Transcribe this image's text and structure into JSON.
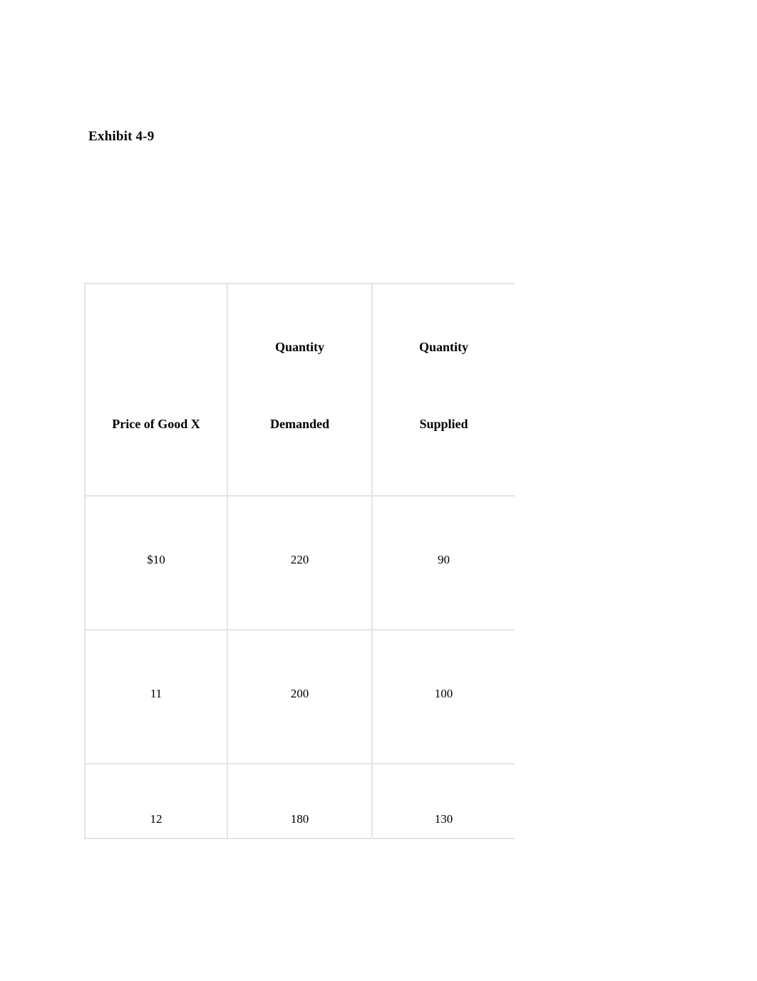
{
  "document": {
    "exhibit_title": "Exhibit 4-9",
    "background_color": "#ffffff",
    "text_color": "#000000",
    "table_border_color": "#e2e2e2"
  },
  "table": {
    "columns": [
      {
        "line1": "",
        "line2": "Price of Good X",
        "single_line": true
      },
      {
        "line1": "Quantity",
        "line2": "Demanded",
        "single_line": false
      },
      {
        "line1": "Quantity",
        "line2": "Supplied",
        "single_line": false
      }
    ],
    "rows": [
      {
        "price": "$10",
        "quantity_demanded": "220",
        "quantity_supplied": "90"
      },
      {
        "price": "11",
        "quantity_demanded": "200",
        "quantity_supplied": "100"
      },
      {
        "price": "12",
        "quantity_demanded": "180",
        "quantity_supplied": "130"
      }
    ]
  },
  "chart_data": {
    "type": "table",
    "title": "Exhibit 4-9",
    "columns": [
      "Price of Good X",
      "Quantity Demanded",
      "Quantity Supplied"
    ],
    "rows": [
      [
        "$10",
        "220",
        "90"
      ],
      [
        "11",
        "200",
        "100"
      ],
      [
        "12",
        "180",
        "130"
      ]
    ],
    "values": {
      "price": [
        10,
        11,
        12
      ],
      "quantity_demanded": [
        220,
        200,
        180
      ],
      "quantity_supplied": [
        90,
        100,
        130
      ]
    },
    "xlabel": "Price of Good X",
    "ylabel": "Quantity"
  }
}
